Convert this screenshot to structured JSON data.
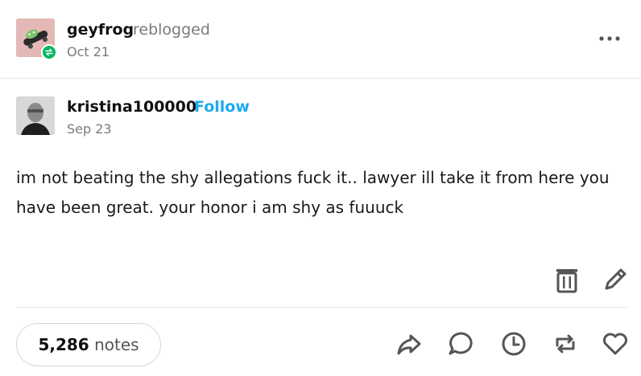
{
  "reblog": {
    "blog_name": "geyfrog",
    "action": "reblogged",
    "date": "Oct 21"
  },
  "post": {
    "author": "kristina100000",
    "follow_label": "Follow",
    "date": "Sep 23",
    "body": "im not beating the shy allegations fuck it.. lawyer ill take it from here you have been great. your honor i am shy as fuuuck"
  },
  "footer": {
    "notes_count": "5,286",
    "notes_label": "notes"
  },
  "icons": {
    "more": "more-horizontal-icon",
    "delete": "trash-icon",
    "edit": "pencil-icon",
    "share": "share-icon",
    "reply": "reply-icon",
    "schedule": "clock-icon",
    "reblog": "reblog-icon",
    "like": "heart-icon"
  },
  "colors": {
    "follow": "#1eaaf1",
    "reblog_badge": "#00b85c"
  }
}
